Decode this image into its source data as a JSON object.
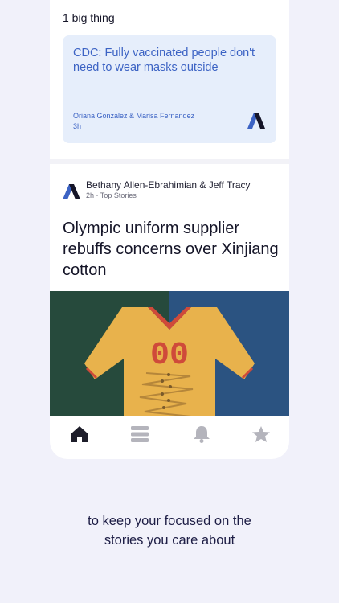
{
  "one_big_thing": {
    "label": "1 big thing",
    "headline": "CDC: Fully vaccinated people don't need to wear masks outside",
    "authors": "Oriana Gonzalez & Marisa Fernandez",
    "time": "3h"
  },
  "story": {
    "authors": "Bethany Allen-Ebrahimian & Jeff Tracy",
    "time": "2h",
    "separator": "·",
    "section": "Top Stories",
    "headline": "Olympic uniform supplier rebuffs concerns over Xinjiang cotton",
    "image_text": "00"
  },
  "tabs": [
    {
      "name": "home-icon",
      "active": true
    },
    {
      "name": "menu-icon",
      "active": false
    },
    {
      "name": "bell-icon",
      "active": false
    },
    {
      "name": "star-icon",
      "active": false
    }
  ],
  "tagline_line1": "to keep your focused on the",
  "tagline_line2": "stories you care about",
  "colors": {
    "accent_blue": "#3c63c4",
    "highlight_bg": "#e6eefb",
    "page_bg": "#f1f1fa",
    "active_tab": "#1d1d2a",
    "inactive_tab": "#b4b4bc"
  }
}
